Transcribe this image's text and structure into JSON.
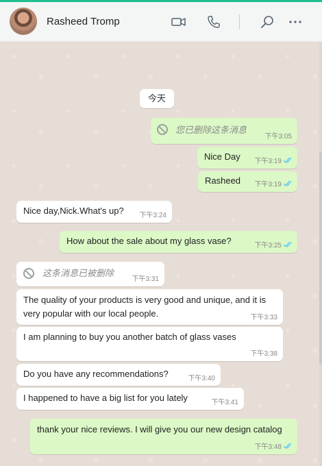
{
  "contact": {
    "name": "Rasheed Tromp"
  },
  "header_icons": [
    "video-call-icon",
    "voice-call-icon",
    "search-icon",
    "more-options-icon"
  ],
  "date_label": "今天",
  "colors": {
    "incoming": "#ffffff",
    "outgoing": "#dcf8c6",
    "read_ticks": "#4fc3f7",
    "accent": "#1fbf8f"
  },
  "messages": [
    {
      "dir": "out",
      "deleted": true,
      "text": "您已删除这条消息",
      "time": "下午3:05",
      "read": false
    },
    {
      "dir": "out",
      "text": "Nice Day",
      "time": "下午3:19",
      "read": true
    },
    {
      "dir": "out",
      "text": "Rasheed",
      "time": "下午3:19",
      "read": true
    },
    {
      "dir": "in",
      "text": "Nice day,Nick.What's up?",
      "time": "下午3:24"
    },
    {
      "dir": "out",
      "text": "How about the sale about my glass vase?",
      "time": "下午3:25",
      "read": true
    },
    {
      "dir": "in",
      "deleted": true,
      "text": "这条消息已被删除",
      "time": "下午3:31"
    },
    {
      "dir": "in",
      "text": "The quality of your products is very good and unique, and it is very popular with our local people.",
      "time": "下午3:33"
    },
    {
      "dir": "in",
      "text": "I am planning to buy you another batch of glass vases",
      "time": "下午3:38"
    },
    {
      "dir": "in",
      "text": "Do you have any recommendations?",
      "time": "下午3:40"
    },
    {
      "dir": "in",
      "text": "I happened to have a big list for you lately",
      "time": "下午3:41"
    },
    {
      "dir": "out",
      "text": "thank your  nice  reviews.   I will give you our new design catalog",
      "time": "下午3:48",
      "read": true
    }
  ]
}
